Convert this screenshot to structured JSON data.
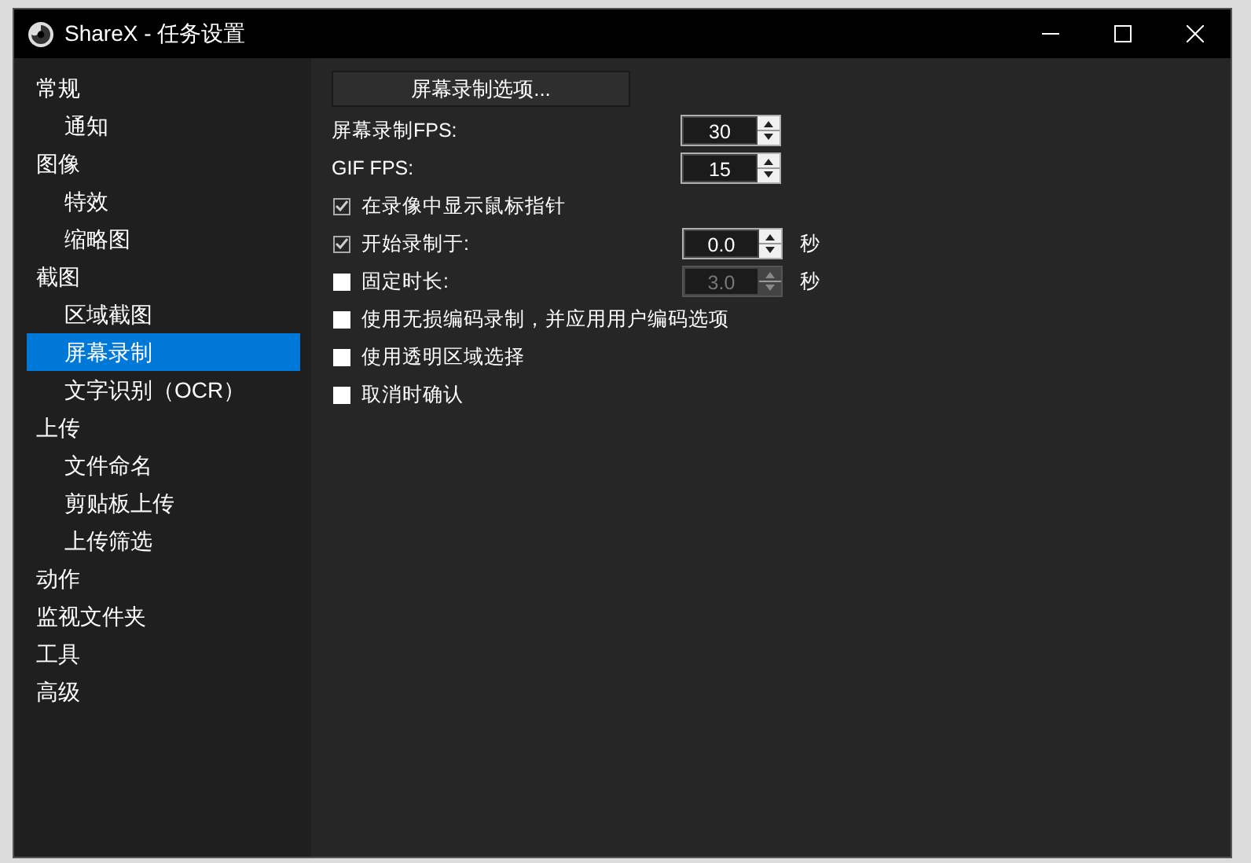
{
  "window": {
    "title": "ShareX - 任务设置"
  },
  "sidebar": {
    "items": [
      {
        "label": "常规",
        "selected": false,
        "children": [
          {
            "label": "通知",
            "selected": false
          }
        ]
      },
      {
        "label": "图像",
        "selected": false,
        "children": [
          {
            "label": "特效",
            "selected": false
          },
          {
            "label": "缩略图",
            "selected": false
          }
        ]
      },
      {
        "label": "截图",
        "selected": false,
        "children": [
          {
            "label": "区域截图",
            "selected": false
          },
          {
            "label": "屏幕录制",
            "selected": true
          },
          {
            "label": "文字识别（OCR）",
            "selected": false
          }
        ]
      },
      {
        "label": "上传",
        "selected": false,
        "children": [
          {
            "label": "文件命名",
            "selected": false
          },
          {
            "label": "剪贴板上传",
            "selected": false
          },
          {
            "label": "上传筛选",
            "selected": false
          }
        ]
      },
      {
        "label": "动作",
        "selected": false
      },
      {
        "label": "监视文件夹",
        "selected": false
      },
      {
        "label": "工具",
        "selected": false
      },
      {
        "label": "高级",
        "selected": false
      }
    ]
  },
  "content": {
    "options_button": "屏幕录制选项...",
    "settings": [
      {
        "kind": "spinner",
        "label": "屏幕录制FPS:",
        "value": "30",
        "disabled": false
      },
      {
        "kind": "spinner",
        "label": "GIF FPS:",
        "value": "15",
        "disabled": false
      },
      {
        "kind": "checkbox",
        "label": "在录像中显示鼠标指针",
        "checked": true
      },
      {
        "kind": "checkbox_spinner",
        "label": "开始录制于:",
        "checked": true,
        "value": "0.0",
        "unit": "秒",
        "disabled": false
      },
      {
        "kind": "checkbox_spinner",
        "label": "固定时长:",
        "checked": false,
        "value": "3.0",
        "unit": "秒",
        "disabled": true
      },
      {
        "kind": "checkbox",
        "label": "使用无损编码录制，并应用用户编码选项",
        "checked": false
      },
      {
        "kind": "checkbox",
        "label": "使用透明区域选择",
        "checked": false
      },
      {
        "kind": "checkbox",
        "label": "取消时确认",
        "checked": false
      }
    ]
  }
}
